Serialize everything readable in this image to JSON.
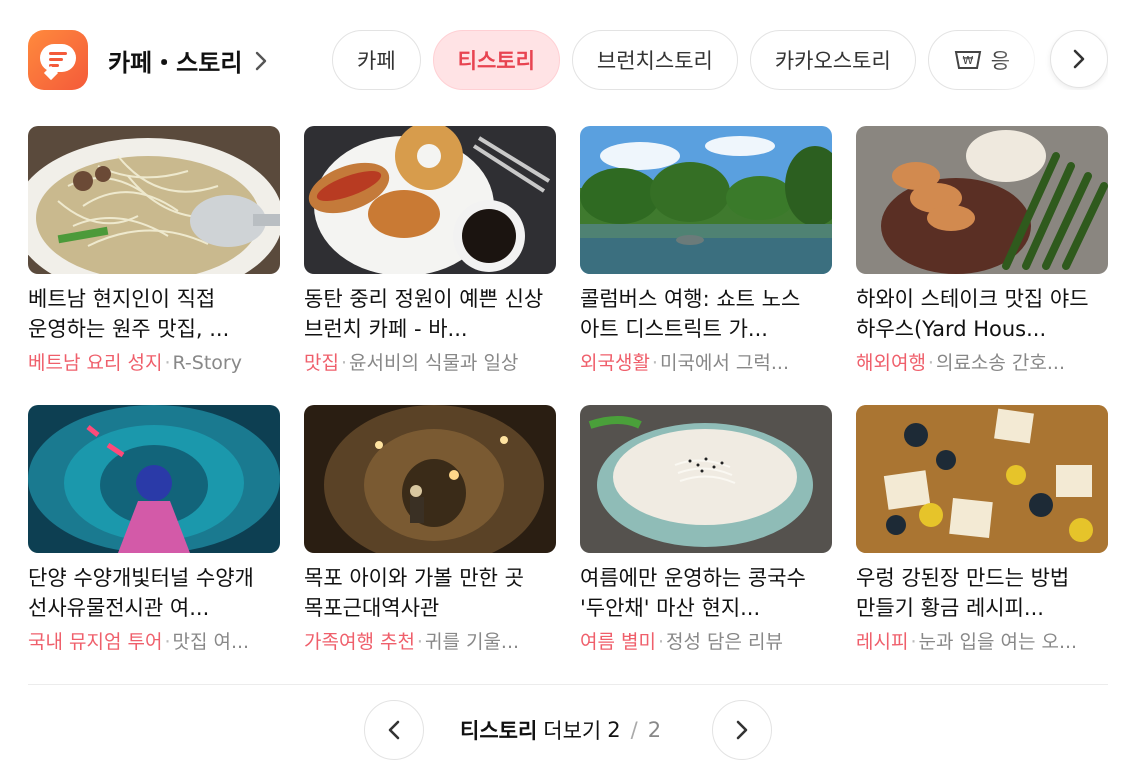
{
  "header": {
    "title": "카페・스토리",
    "tabs": [
      {
        "label": "카페",
        "active": false
      },
      {
        "label": "티스토리",
        "active": true
      },
      {
        "label": "브런치스토리",
        "active": false
      },
      {
        "label": "카카오스토리",
        "active": false
      },
      {
        "label": "응",
        "active": false,
        "icon": "store-icon"
      }
    ]
  },
  "cards": [
    {
      "title": "베트남 현지인이 직접 운영하는 원주 맛집, ...",
      "category": "베트남 요리 성지",
      "source": "R-Story"
    },
    {
      "title": "동탄 중리 정원이 예쁜 신상 브런치 카페 - 바...",
      "category": "맛집",
      "source": "윤서비의 식물과 일상"
    },
    {
      "title": "콜럼버스 여행: 쇼트 노스 아트 디스트릭트 가...",
      "category": "외국생활",
      "source": "미국에서 그럭..."
    },
    {
      "title": "하와이 스테이크 맛집 야드 하우스(Yard Hous...",
      "category": "해외여행",
      "source": "의료소송 간호..."
    },
    {
      "title": "단양 수양개빛터널 수양개 선사유물전시관 여...",
      "category": "국내 뮤지엄 투어",
      "source": "맛집 여..."
    },
    {
      "title": "목포 아이와 가볼 만한 곳 목포근대역사관",
      "category": "가족여행 추천",
      "source": "귀를 기울..."
    },
    {
      "title": "여름에만 운영하는 콩국수 '두안채' 마산 현지...",
      "category": "여름 별미",
      "source": "정성 담은 리뷰"
    },
    {
      "title": "우렁 강된장 만드는 방법 만들기 황금 레시피...",
      "category": "레시피",
      "source": "눈과 입을 여는 오..."
    }
  ],
  "pager": {
    "label": "티스토리",
    "more": "더보기",
    "current": "2",
    "separator": "/",
    "total": "2"
  },
  "colors": {
    "accent": "#e84451",
    "category": "#ef5f6b",
    "logo": "#f45a3a"
  }
}
